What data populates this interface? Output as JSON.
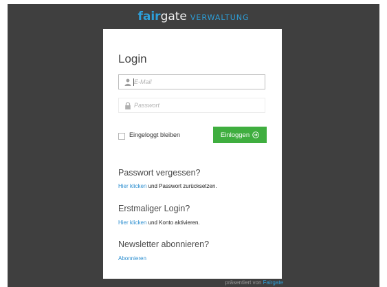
{
  "logo": {
    "part1": "fair",
    "part2": "gate",
    "part3": "VERWALTUNG"
  },
  "login": {
    "title": "Login",
    "email_placeholder": "E-Mail",
    "password_placeholder": "Passwort",
    "remember_label": "Eingeloggt bleiben",
    "button_label": "Einloggen"
  },
  "forgot": {
    "title": "Passwort vergessen?",
    "link": "Hier klicken",
    "text": " und Passwort zurücksetzen."
  },
  "first_login": {
    "title": "Erstmaliger Login?",
    "link": "Hier klicken",
    "text": " und Konto aktivieren."
  },
  "newsletter": {
    "title": "Newsletter abonnieren?",
    "link": "Abonnieren"
  },
  "footer": {
    "text": "präsentiert von ",
    "link": "Fairgate"
  },
  "colors": {
    "accent": "#2d9fd9",
    "button": "#3fae3f",
    "background": "#3f3f3f"
  },
  "icons": {
    "email": "user-icon",
    "password": "lock-icon",
    "button": "arrow-circle-icon"
  }
}
